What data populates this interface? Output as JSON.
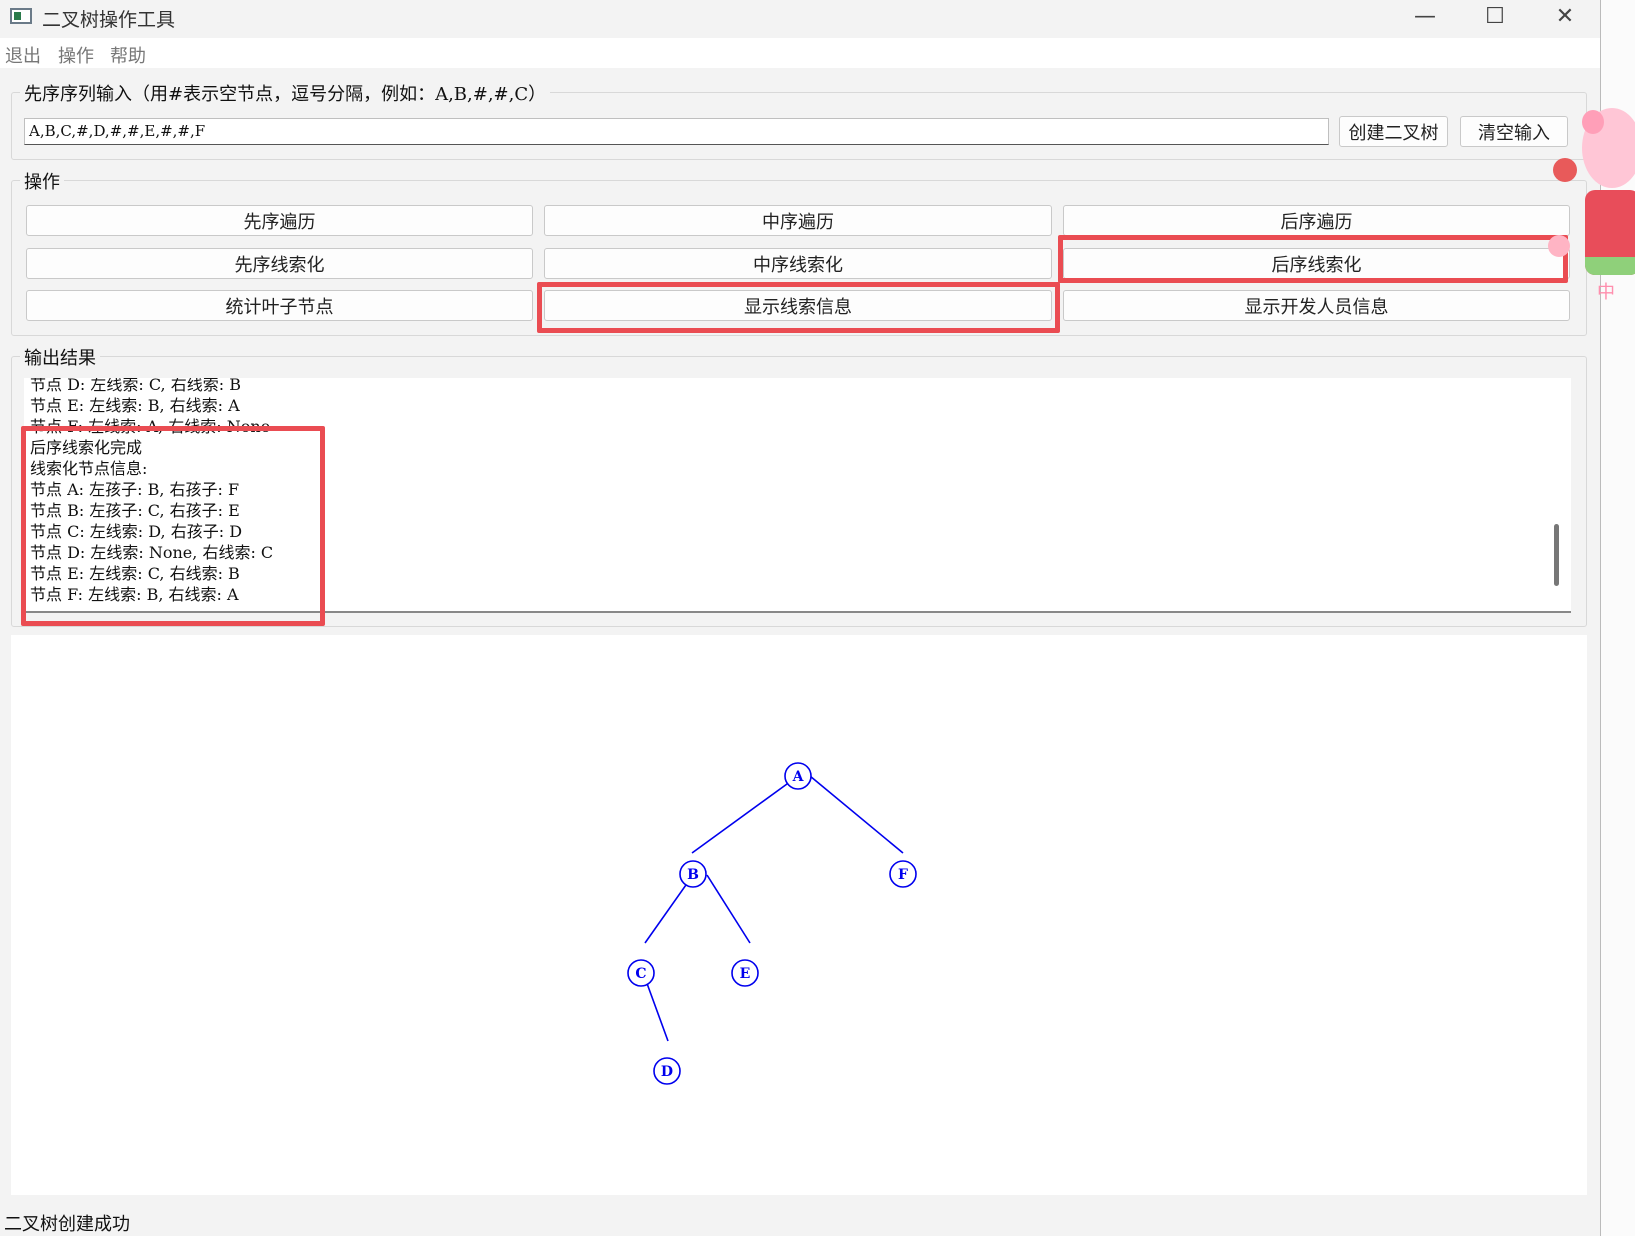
{
  "window": {
    "title": "二叉树操作工具",
    "minimize_glyph": "—",
    "maximize_glyph": "☐",
    "close_glyph": "✕"
  },
  "menu": [
    "退出",
    "操作",
    "帮助"
  ],
  "input_group": {
    "title": "先序序列输入（用#表示空节点，逗号分隔，例如：A,B,#,#,C）",
    "value": "A,B,C,#,D,#,#,E,#,#,F",
    "create_button": "创建二叉树",
    "clear_button": "清空输入"
  },
  "ops_group": {
    "title": "操作",
    "buttons": [
      "先序遍历",
      "中序遍历",
      "后序遍历",
      "先序线索化",
      "中序线索化",
      "后序线索化",
      "统计叶子节点",
      "显示线索信息",
      "显示开发人员信息"
    ]
  },
  "output_group": {
    "title": "输出结果",
    "lines": [
      "节点 D: 左线索: C, 右线索: B",
      "节点 E: 左线索: B, 右线索: A",
      "节点 F: 左线索: A, 右线索: None",
      "后序线索化完成",
      "线索化节点信息:",
      "节点 A: 左孩子: B, 右孩子: F",
      "节点 B: 左孩子: C, 右孩子: E",
      "节点 C: 左线索: D, 右孩子: D",
      "节点 D: 左线索: None, 右线索: C",
      "节点 E: 左线索: C, 右线索: B",
      "节点 F: 左线索: B, 右线索: A"
    ]
  },
  "tree": {
    "color": "#0000ee",
    "nodes": [
      "A",
      "B",
      "F",
      "C",
      "E",
      "D"
    ]
  },
  "status": "二叉树创建成功",
  "colors": {
    "highlight": "#ea4c52",
    "tree_blue": "#0000ee"
  },
  "mascot_text": "中"
}
